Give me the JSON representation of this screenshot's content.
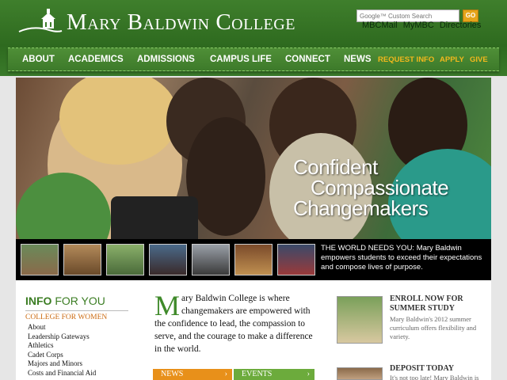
{
  "header": {
    "title": "Mary Baldwin College",
    "search_placeholder": "Google™ Custom Search",
    "go_label": "GO",
    "util_links": [
      "MBCMail",
      "MyMBC",
      "Directories"
    ]
  },
  "nav": {
    "items": [
      "ABOUT",
      "ACADEMICS",
      "ADMISSIONS",
      "CAMPUS LIFE",
      "CONNECT",
      "NEWS"
    ],
    "utility": [
      "REQUEST INFO",
      "APPLY",
      "GIVE"
    ]
  },
  "hero": {
    "lines": [
      "Confident",
      "Compassionate",
      "Changemakers"
    ]
  },
  "strip": {
    "text": "THE WORLD NEEDS YOU: Mary Baldwin empowers students to exceed their expectations and compose lives of purpose."
  },
  "sidebar": {
    "title_bold": "INFO",
    "title_rest": "FOR YOU",
    "section": "COLLEGE FOR WOMEN",
    "links": [
      "About",
      "Leadership Gateways",
      "Athletics",
      "Cadet Corps",
      "Majors and Minors",
      "Costs and Financial Aid"
    ]
  },
  "main": {
    "dropcap": "M",
    "body": "ary Baldwin College is where changemakers are empowered with the confidence to lead, the compassion to serve, and the courage to make a difference in the world.",
    "tabs": [
      "NEWS",
      "EVENTS"
    ]
  },
  "promos": [
    {
      "title": "ENROLL NOW FOR SUMMER STUDY",
      "body": "Mary Baldwin's 2012 summer curriculum offers flexibility and variety."
    },
    {
      "title": "DEPOSIT TODAY",
      "body": "It's not too late! Mary Baldwin is"
    }
  ],
  "colors": {
    "brand_green": "#3b7d23",
    "accent_gold": "#f2b81c",
    "link_orange": "#cc6a10"
  }
}
